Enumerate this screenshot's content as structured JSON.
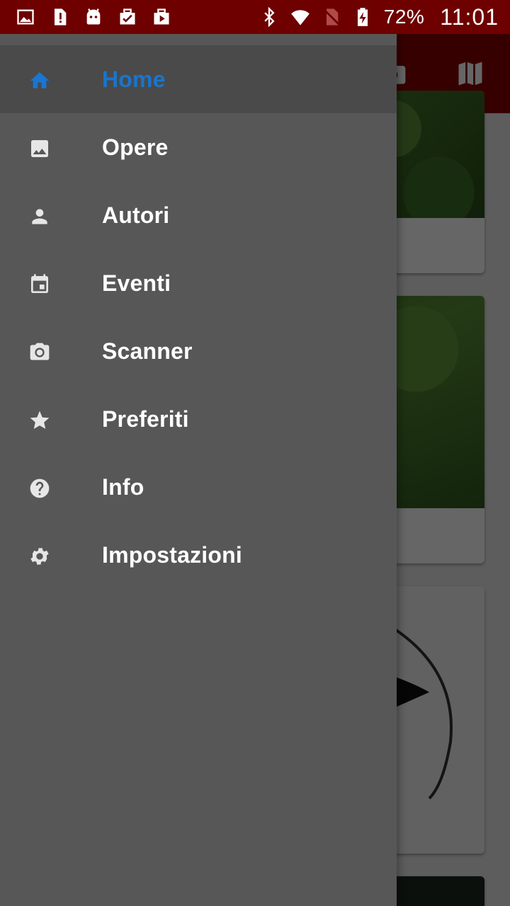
{
  "status_bar": {
    "left_icons": [
      "gallery-icon",
      "sim-alert-icon",
      "android-icon",
      "task-check-icon",
      "play-store-icon"
    ],
    "right_icons": [
      "bluetooth-icon",
      "wifi-icon",
      "no-sim-icon",
      "battery-charging-icon"
    ],
    "battery": "72%",
    "time": "11:01",
    "bar_color": "#6e0000"
  },
  "toolbar": {
    "color": "#8a0000",
    "actions": [
      "camera-icon",
      "map-icon"
    ]
  },
  "drawer": {
    "active_color": "#1976d2",
    "items": [
      {
        "label": "Home",
        "icon": "home-icon",
        "active": true
      },
      {
        "label": "Opere",
        "icon": "image-icon",
        "active": false
      },
      {
        "label": "Autori",
        "icon": "person-icon",
        "active": false
      },
      {
        "label": "Eventi",
        "icon": "calendar-icon",
        "active": false
      },
      {
        "label": "Scanner",
        "icon": "camera-icon",
        "active": false
      },
      {
        "label": "Preferiti",
        "icon": "star-icon",
        "active": false
      },
      {
        "label": "Info",
        "icon": "help-icon",
        "active": false
      },
      {
        "label": "Impostazioni",
        "icon": "settings-icon",
        "active": false
      }
    ]
  }
}
